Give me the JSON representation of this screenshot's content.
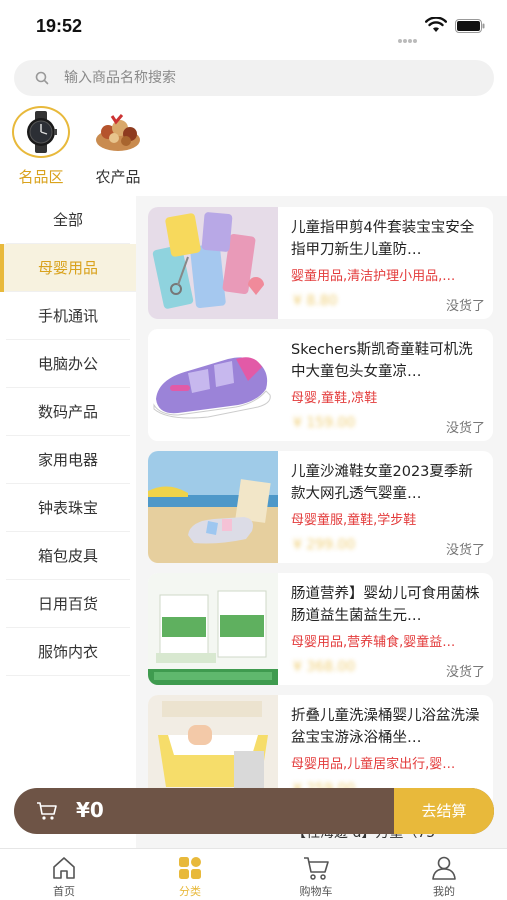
{
  "status": {
    "time": "19:52"
  },
  "search": {
    "placeholder": "输入商品名称搜索"
  },
  "chips": [
    {
      "label": "名品区",
      "icon": "watch-icon"
    },
    {
      "label": "农产品",
      "icon": "nuts-basket-icon"
    }
  ],
  "sidebar": {
    "items": [
      {
        "label": "全部"
      },
      {
        "label": "母婴用品"
      },
      {
        "label": "手机通讯"
      },
      {
        "label": "电脑办公"
      },
      {
        "label": "数码产品"
      },
      {
        "label": "家用电器"
      },
      {
        "label": "钟表珠宝"
      },
      {
        "label": "箱包皮具"
      },
      {
        "label": "日用百货"
      },
      {
        "label": "服饰内衣"
      }
    ],
    "active_index": 1
  },
  "products": [
    {
      "title": "儿童指甲剪4件套装宝宝安全指甲刀新生儿童防…",
      "tags": "婴童用品,清洁护理小用品,…",
      "price": "¥ 8.80",
      "status": "没货了"
    },
    {
      "title": "Skechers斯凯奇童鞋可机洗中大童包头女童凉…",
      "tags": "母婴,童鞋,凉鞋",
      "price": "¥ 159.00",
      "status": "没货了"
    },
    {
      "title": "儿童沙滩鞋女童2023夏季新款大网孔透气婴童…",
      "tags": "母婴童服,童鞋,学步鞋",
      "price": "¥ 299.00",
      "status": "没货了"
    },
    {
      "title": "肠道营养】婴幼儿可食用菌株肠道益生菌益生元…",
      "tags": "母婴用品,营养辅食,婴童益…",
      "price": "¥ 368.00",
      "status": "没货了"
    },
    {
      "title": "折叠儿童洗澡桶婴儿浴盆洗澡盆宝宝游泳浴桶坐…",
      "tags": "母婴用品,儿童居家出行,婴…",
      "price": "¥ 259.00",
      "status": ""
    }
  ],
  "partial_row_text": "【社海遊 d】方重（75-",
  "cart": {
    "total": "¥0",
    "checkout_label": "去结算"
  },
  "tabs": [
    {
      "label": "首页",
      "icon": "home-icon"
    },
    {
      "label": "分类",
      "icon": "category-icon"
    },
    {
      "label": "购物车",
      "icon": "cart-icon"
    },
    {
      "label": "我的",
      "icon": "user-icon"
    }
  ],
  "colors": {
    "accent": "#e8b93b",
    "tag_red": "#e33b3b",
    "cart_bar": "#6e5446"
  }
}
